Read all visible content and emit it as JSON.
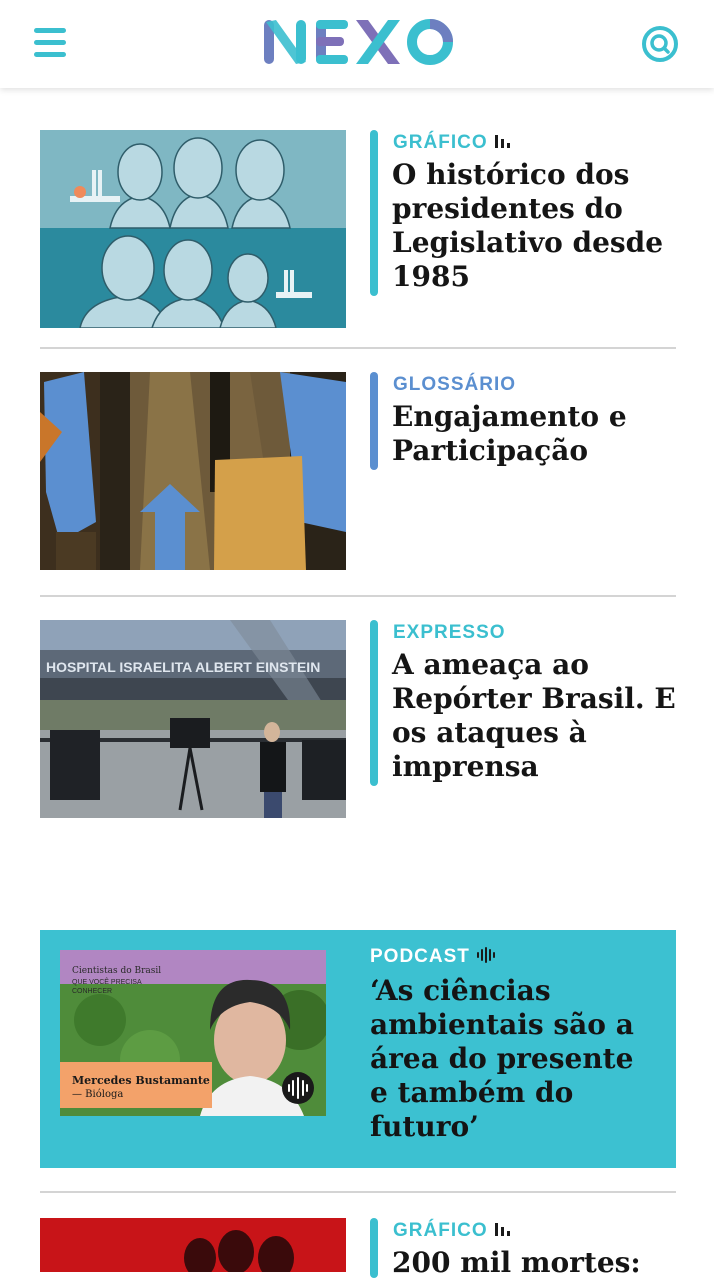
{
  "header": {
    "logo_text": "NEXO",
    "menu_icon": "hamburger-icon",
    "search_icon": "search-icon"
  },
  "colors": {
    "brand_teal": "#3bbfcf",
    "accent_blue": "#5b8fd0",
    "podcast_bg": "#3cc1d1",
    "divider": "#d4d4d4"
  },
  "articles": [
    {
      "kicker": "GRÁFICO",
      "kicker_icon": "bar-chart-icon",
      "kicker_color": "#3bbfcf",
      "headline": "O histórico dos presidentes do Legislativo desde 1985"
    },
    {
      "kicker": "GLOSSÁRIO",
      "kicker_icon": "",
      "kicker_color": "#5b8fd0",
      "headline": "Engajamento e Participação"
    },
    {
      "kicker": "EXPRESSO",
      "kicker_icon": "",
      "kicker_color": "#3bbfcf",
      "headline": "A ameaça ao Repórter Brasil. E os ataques à imprensa"
    }
  ],
  "podcast": {
    "kicker": "PODCAST",
    "kicker_icon": "audio-wave-icon",
    "headline": "‘As ciências ambientais são a área do presente e também do futuro’",
    "thumb": {
      "series_title": "Cientistas do Brasil",
      "series_subtitle": "QUE VOCÊ PRECISA CONHECER",
      "guest_name": "Mercedes Bustamante",
      "guest_role": "— Bióloga",
      "play_icon": "audio-wave-icon"
    }
  },
  "next_article": {
    "kicker": "GRÁFICO",
    "kicker_icon": "bar-chart-icon",
    "headline": "200 mil mortes:"
  }
}
